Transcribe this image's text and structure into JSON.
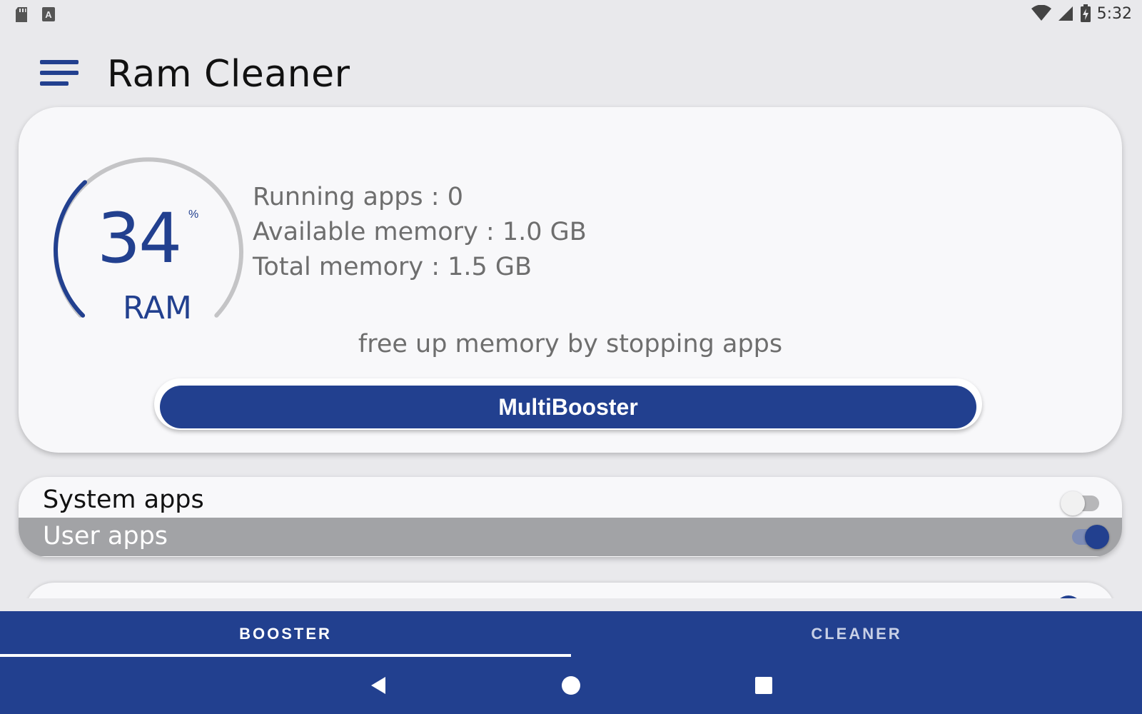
{
  "status_bar": {
    "time": "5:32",
    "icons": [
      "sd-card-icon",
      "keyboard-a-icon",
      "wifi-icon",
      "cell-signal-icon",
      "battery-charging-icon"
    ]
  },
  "app_bar": {
    "title": "Ram Cleaner",
    "menu_icon": "hamburger-menu-icon"
  },
  "ram_gauge": {
    "value": "34",
    "percent_sign": "%",
    "label": "RAM",
    "used_fraction": 0.34,
    "colors": {
      "arc": "#22408f",
      "track": "#c4c4c6"
    }
  },
  "stats": {
    "running_apps": "Running apps : 0",
    "available_memory": "Available memory : 1.0 GB",
    "total_memory": "Total memory : 1.5 GB"
  },
  "hint": "free up memory by stopping apps",
  "boost_button": {
    "label": "MultiBooster"
  },
  "filters": {
    "system_apps": {
      "label": "System apps",
      "enabled": false
    },
    "user_apps": {
      "label": "User apps",
      "enabled": true
    }
  },
  "tabs": [
    {
      "label": "BOOSTER",
      "active": true
    },
    {
      "label": "CLEANER",
      "active": false
    }
  ],
  "nav": [
    "back-icon",
    "home-icon",
    "recents-icon"
  ],
  "colors": {
    "brand": "#22408f",
    "background": "#e9e9ec",
    "card": "#f8f8fa"
  }
}
